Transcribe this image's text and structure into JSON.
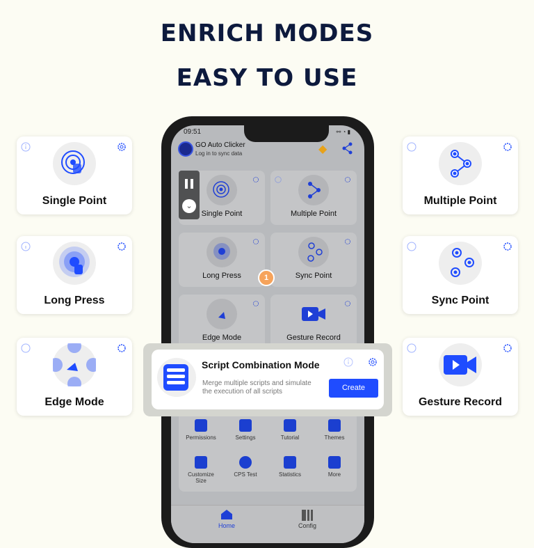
{
  "headline": [
    "ENRICH MODES",
    "EASY TO USE"
  ],
  "colors": {
    "accent": "#1f4cff",
    "title": "#0d1a3d",
    "background": "#fcfcf3"
  },
  "side_cards": {
    "left": [
      {
        "label": "Single Point",
        "icon": "single-point-icon"
      },
      {
        "label": "Long Press",
        "icon": "long-press-icon"
      },
      {
        "label": "Edge Mode",
        "icon": "edge-mode-icon"
      }
    ],
    "right": [
      {
        "label": "Multiple Point",
        "icon": "multiple-point-icon"
      },
      {
        "label": "Sync Point",
        "icon": "sync-point-icon"
      },
      {
        "label": "Gesture Record",
        "icon": "gesture-record-icon"
      }
    ]
  },
  "phone": {
    "status_time": "09:51",
    "app_title": "GO Auto Clicker",
    "app_subtitle": "Log in to sync data",
    "modes": [
      "Single Point",
      "Multiple Point",
      "Long Press",
      "Sync Point",
      "Edge Mode",
      "Gesture Record"
    ],
    "step_badge": "1",
    "tools": [
      "Permissions",
      "Settings",
      "Tutorial",
      "Themes",
      "Customize Size",
      "CPS Test",
      "Statistics",
      "More"
    ],
    "nav": [
      {
        "label": "Home",
        "active": true
      },
      {
        "label": "Config",
        "active": false
      }
    ]
  },
  "popup": {
    "title": "Script Combination Mode",
    "description": "Merge multiple scripts and simulate the execution of all scripts",
    "button": "Create"
  }
}
